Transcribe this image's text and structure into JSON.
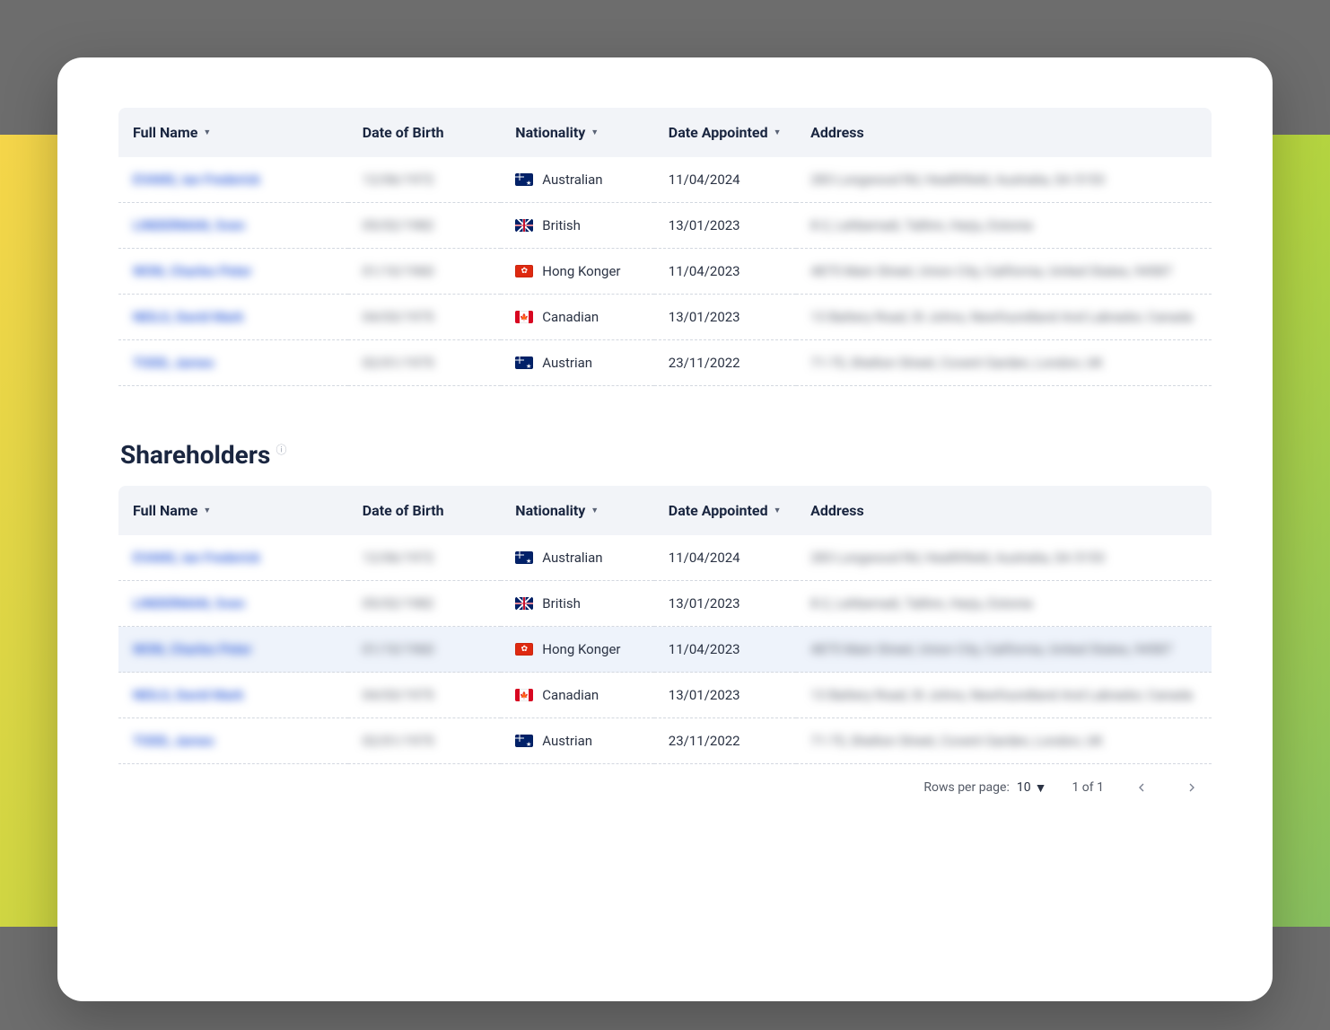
{
  "tables": {
    "top": {
      "columns": {
        "full_name": {
          "label": "Full Name",
          "sortable": true
        },
        "dob": {
          "label": "Date of Birth",
          "sortable": false
        },
        "nationality": {
          "label": "Nationality",
          "sortable": true
        },
        "appointed": {
          "label": "Date Appointed",
          "sortable": true
        },
        "address": {
          "label": "Address",
          "sortable": false
        }
      },
      "rows": [
        {
          "name": "EVANS, Ian Frederick",
          "dob": "12/06/1972",
          "nat": "Australian",
          "flag": "au",
          "appointed": "11/04/2024",
          "address": "283 Longwood Rd, Healthfield, Australia, SA 5153"
        },
        {
          "name": "LINDERMAN, Sven",
          "dob": "05/02/1982",
          "nat": "British",
          "flag": "gb",
          "appointed": "13/01/2023",
          "address": "8-2, Lehberradi, Tallinn, Harju, Estonia"
        },
        {
          "name": "WON, Charles Peter",
          "dob": "01/10/1960",
          "nat": "Hong Konger",
          "flag": "hk",
          "appointed": "11/04/2023",
          "address": "4875 Main Street, Union City, California, United States, 94587"
        },
        {
          "name": "NEILS, David Mark",
          "dob": "04/03/1975",
          "nat": "Canadian",
          "flag": "ca",
          "appointed": "13/01/2023",
          "address": "13 Battery Road, St Johns, Newfoundland And Labrador, Canada"
        },
        {
          "name": "TODD, James",
          "dob": "02/01/1975",
          "nat": "Austrian",
          "flag": "au",
          "appointed": "23/11/2022",
          "address": "71-75, Shelton Street, Covent Garden, London, UK"
        }
      ]
    },
    "shareholders": {
      "heading": "Shareholders",
      "columns": {
        "full_name": {
          "label": "Full Name",
          "sortable": true
        },
        "dob": {
          "label": "Date of Birth",
          "sortable": false
        },
        "nationality": {
          "label": "Nationality",
          "sortable": true
        },
        "appointed": {
          "label": "Date Appointed",
          "sortable": true
        },
        "address": {
          "label": "Address",
          "sortable": false
        }
      },
      "rows": [
        {
          "name": "EVANS, Ian Frederick",
          "dob": "12/06/1972",
          "nat": "Australian",
          "flag": "au",
          "appointed": "11/04/2024",
          "address": "283 Longwood Rd, Healthfield, Australia, SA 5153"
        },
        {
          "name": "LINDERMAN, Sven",
          "dob": "05/02/1982",
          "nat": "British",
          "flag": "gb",
          "appointed": "13/01/2023",
          "address": "8-2, Lehberradi, Tallinn, Harju, Estonia"
        },
        {
          "name": "WON, Charles Peter",
          "dob": "01/10/1960",
          "nat": "Hong Konger",
          "flag": "hk",
          "appointed": "11/04/2023",
          "address": "4875 Main Street, Union City, California, United States, 94587",
          "hover": true
        },
        {
          "name": "NEILS, David Mark",
          "dob": "04/03/1975",
          "nat": "Canadian",
          "flag": "ca",
          "appointed": "13/01/2023",
          "address": "13 Battery Road, St Johns, Newfoundland And Labrador, Canada"
        },
        {
          "name": "TODD, James",
          "dob": "02/01/1975",
          "nat": "Austrian",
          "flag": "au",
          "appointed": "23/11/2022",
          "address": "71-75, Shelton Street, Covent Garden, London, UK"
        }
      ]
    }
  },
  "pagination": {
    "rows_per_page_label": "Rows per page:",
    "rows_per_page_value": "10",
    "range_label": "1 of 1"
  }
}
